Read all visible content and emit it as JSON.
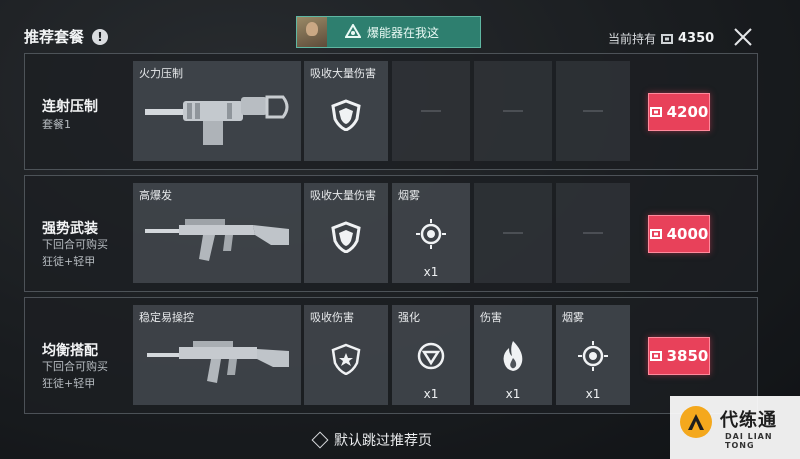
{
  "header": {
    "title": "推荐套餐",
    "info_icon_glyph": "!",
    "banner_text": "爆能器在我这",
    "wallet_label": "当前持有",
    "wallet_amount": "4350"
  },
  "colors": {
    "accent_red": "#e8415a",
    "banner_green": "#2e7f6f"
  },
  "packages": [
    {
      "name": "连射压制",
      "subtitle": [
        "套餐1"
      ],
      "weapon_label": "火力压制",
      "weapon_icon": "machine-gun",
      "items": [
        {
          "label": "吸收大量伤害",
          "icon": "heavy-armor-icon",
          "count": ""
        },
        {
          "empty": true
        },
        {
          "empty": true
        },
        {
          "empty": true
        }
      ],
      "price": "4200"
    },
    {
      "name": "强势武装",
      "subtitle": [
        "下回合可购买",
        "狂徒+轻甲"
      ],
      "weapon_label": "高爆发",
      "weapon_icon": "assault-rifle",
      "items": [
        {
          "label": "吸收大量伤害",
          "icon": "heavy-armor-icon",
          "count": ""
        },
        {
          "label": "烟雾",
          "icon": "smoke-icon",
          "count": "x1"
        },
        {
          "empty": true
        },
        {
          "empty": true
        }
      ],
      "price": "4000"
    },
    {
      "name": "均衡搭配",
      "subtitle": [
        "下回合可购买",
        "狂徒+轻甲"
      ],
      "weapon_label": "稳定易操控",
      "weapon_icon": "rifle",
      "items": [
        {
          "label": "吸收伤害",
          "icon": "light-armor-icon",
          "count": ""
        },
        {
          "label": "强化",
          "icon": "enhance-icon",
          "count": "x1"
        },
        {
          "label": "伤害",
          "icon": "flame-icon",
          "count": "x1"
        },
        {
          "label": "烟雾",
          "icon": "smoke-icon",
          "count": "x1"
        }
      ],
      "price": "3850"
    }
  ],
  "footer": {
    "skip_label": "默认跳过推荐页"
  },
  "watermark": {
    "title": "代练通",
    "subtitle": "DAI LIAN TONG"
  }
}
